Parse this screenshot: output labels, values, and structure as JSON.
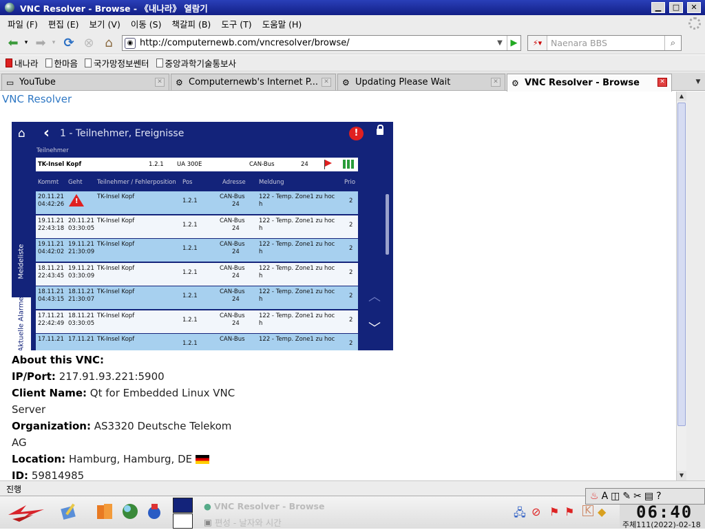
{
  "window": {
    "title": "VNC Resolver - Browse - 《내나라》 열람기"
  },
  "menu": [
    "파일 (F)",
    "편집 (E)",
    "보기 (V)",
    "이동 (S)",
    "책갈피 (B)",
    "도구 (T)",
    "도움말 (H)"
  ],
  "nav": {
    "url": "http://computernewb.com/vncresolver/browse/",
    "search_placeholder": "Naenara BBS"
  },
  "bookmarks": [
    "내나라",
    "한마음",
    "국가망정보쎈터",
    "중앙과학기술통보사"
  ],
  "tabs": [
    {
      "label": "YouTube"
    },
    {
      "label": "Computernewb's Internet P..."
    },
    {
      "label": "Updating Please Wait"
    },
    {
      "label": "VNC Resolver - Browse"
    }
  ],
  "page": {
    "site_link": "VNC Resolver",
    "vnc": {
      "title": "1 - Teilnehmer, Ereignisse",
      "participant_label": "Teilnehmer",
      "participant": {
        "name": "TK-Insel Kopf",
        "pos": "1.2.1",
        "device": "UA 300E",
        "bus": "CAN-Bus",
        "addr": "24"
      },
      "columns": [
        "Kommt",
        "Geht",
        "Teilnehmer / Fehlerposition",
        "Pos",
        "Adresse",
        "Meldung",
        "Prio"
      ],
      "side_tabs": [
        "Meldeliste",
        "Aktuelle Alarme"
      ],
      "rows": [
        {
          "kommt1": "20.11.21",
          "kommt2": "04:42:26",
          "geht1": "",
          "geht2": "",
          "teil": "TK-Insel Kopf",
          "pos": "1.2.1",
          "adr1": "CAN-Bus",
          "adr2": "24",
          "msg1": "122 - Temp. Zone1 zu hoc",
          "msg2": "h",
          "prio": "2"
        },
        {
          "kommt1": "19.11.21",
          "kommt2": "22:43:18",
          "geht1": "20.11.21",
          "geht2": "03:30:05",
          "teil": "TK-Insel Kopf",
          "pos": "1.2.1",
          "adr1": "CAN-Bus",
          "adr2": "24",
          "msg1": "122 - Temp. Zone1 zu hoc",
          "msg2": "h",
          "prio": "2"
        },
        {
          "kommt1": "19.11.21",
          "kommt2": "04:42:02",
          "geht1": "19.11.21",
          "geht2": "21:30:09",
          "teil": "TK-Insel Kopf",
          "pos": "1.2.1",
          "adr1": "CAN-Bus",
          "adr2": "24",
          "msg1": "122 - Temp. Zone1 zu hoc",
          "msg2": "h",
          "prio": "2"
        },
        {
          "kommt1": "18.11.21",
          "kommt2": "22:43:45",
          "geht1": "19.11.21",
          "geht2": "03:30:09",
          "teil": "TK-Insel Kopf",
          "pos": "1.2.1",
          "adr1": "CAN-Bus",
          "adr2": "24",
          "msg1": "122 - Temp. Zone1 zu hoc",
          "msg2": "h",
          "prio": "2"
        },
        {
          "kommt1": "18.11.21",
          "kommt2": "04:43:15",
          "geht1": "18.11.21",
          "geht2": "21:30:07",
          "teil": "TK-Insel Kopf",
          "pos": "1.2.1",
          "adr1": "CAN-Bus",
          "adr2": "24",
          "msg1": "122 - Temp. Zone1 zu hoc",
          "msg2": "h",
          "prio": "2"
        },
        {
          "kommt1": "17.11.21",
          "kommt2": "22:42:49",
          "geht1": "18.11.21",
          "geht2": "03:30:05",
          "teil": "TK-Insel Kopf",
          "pos": "1.2.1",
          "adr1": "CAN-Bus",
          "adr2": "24",
          "msg1": "122 - Temp. Zone1 zu hoc",
          "msg2": "h",
          "prio": "2"
        },
        {
          "kommt1": "17.11.21",
          "kommt2": "",
          "geht1": "17.11.21",
          "geht2": "",
          "teil": "TK-Insel Kopf",
          "pos": "1.2.1",
          "adr1": "CAN-Bus",
          "adr2": "",
          "msg1": "122 - Temp. Zone1 zu hoc",
          "msg2": "",
          "prio": "2"
        }
      ]
    },
    "about": {
      "heading": "About this VNC:",
      "ip_label": "IP/Port:",
      "ip": "217.91.93.221:5900",
      "client_label": "Client Name:",
      "client": "Qt for Embedded Linux VNC Server",
      "org_label": "Organization:",
      "org": "AS3320 Deutsche Telekom AG",
      "loc_label": "Location:",
      "loc": "Hamburg, Hamburg, DE",
      "id_label": "ID:",
      "id": "59814985"
    }
  },
  "status": {
    "text": "진행"
  },
  "taskbar": {
    "windows": [
      "VNC Resolver - Browse",
      "편성 - 날자와 시간"
    ],
    "clock_time": "06:40",
    "clock_date": "주체111(2022)-02-18"
  }
}
